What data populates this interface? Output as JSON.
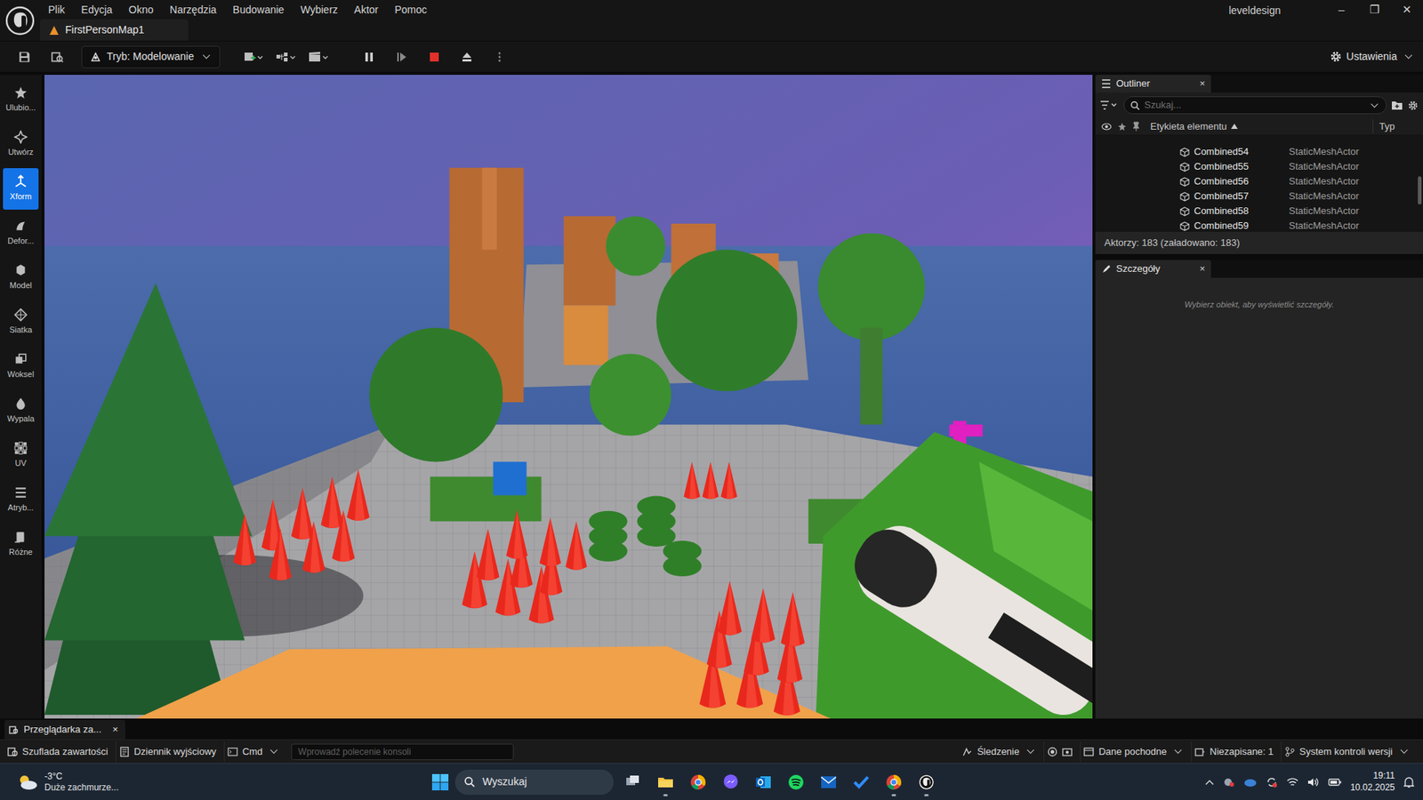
{
  "window": {
    "title": "leveldesign",
    "tab": "FirstPersonMap1",
    "controls": [
      "–",
      "❐",
      "✕"
    ]
  },
  "menu": [
    "Plik",
    "Edycja",
    "Okno",
    "Narzędzia",
    "Budowanie",
    "Wybierz",
    "Aktor",
    "Pomoc"
  ],
  "toolbar": {
    "mode": "Tryb: Modelowanie",
    "settings": "Ustawienia"
  },
  "tools": [
    {
      "label": "Ulubio...",
      "selected": false
    },
    {
      "label": "Utwórz",
      "selected": false
    },
    {
      "label": "Xform",
      "selected": true
    },
    {
      "label": "Defor...",
      "selected": false
    },
    {
      "label": "Model",
      "selected": false
    },
    {
      "label": "Siatka",
      "selected": false
    },
    {
      "label": "Woksel",
      "selected": false
    },
    {
      "label": "Wypala",
      "selected": false
    },
    {
      "label": "UV",
      "selected": false
    },
    {
      "label": "Atryb...",
      "selected": false
    },
    {
      "label": "Różne",
      "selected": false
    }
  ],
  "outliner": {
    "title": "Outliner",
    "close": "×",
    "search": {
      "placeholder": "Szukaj..."
    },
    "columns": [
      {
        "label": "Etykieta elementu",
        "sorted": true
      },
      {
        "label": "Typ",
        "sorted": false
      }
    ],
    "rows": [
      {
        "label": "Combined54",
        "type": "StaticMeshActor"
      },
      {
        "label": "Combined55",
        "type": "StaticMeshActor"
      },
      {
        "label": "Combined56",
        "type": "StaticMeshActor"
      },
      {
        "label": "Combined57",
        "type": "StaticMeshActor"
      },
      {
        "label": "Combined58",
        "type": "StaticMeshActor"
      },
      {
        "label": "Combined59",
        "type": "StaticMeshActor"
      }
    ],
    "footer": "Aktorzy: 183 (załadowano: 183)"
  },
  "details": {
    "title": "Szczegóły",
    "close": "×",
    "hint": "Wybierz obiekt, aby wyświetlić szczegóły."
  },
  "bottom_tab": {
    "label": "Przeglądarka za...",
    "close": "×"
  },
  "status_bar": {
    "left": [
      "Szuflada zawartości",
      "Dziennik wyjściowy"
    ],
    "cmd": "Cmd",
    "console_placeholder": "Wprowadź polecenie konsoli",
    "right": [
      "Śledzenie",
      "Dane pochodne",
      "Niezapisane: 1",
      "System kontroli wersji"
    ]
  },
  "taskbar": {
    "weather": {
      "temp": "-3°C",
      "desc": "Duże zachmurze..."
    },
    "search": "Wyszukaj",
    "time": "19:11",
    "date": "10.02.2025"
  }
}
